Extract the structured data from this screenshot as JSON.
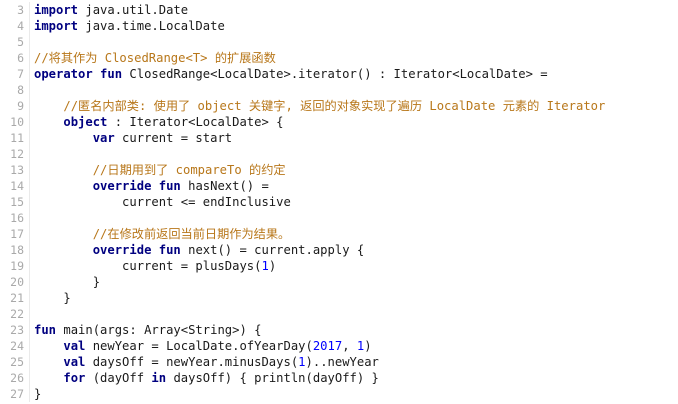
{
  "editor": {
    "language": "Kotlin",
    "lines": [
      {
        "n": "3",
        "tokens": [
          {
            "t": "kw",
            "v": "import"
          },
          {
            "t": "txt",
            "v": " java.util.Date"
          }
        ]
      },
      {
        "n": "4",
        "tokens": [
          {
            "t": "kw",
            "v": "import"
          },
          {
            "t": "txt",
            "v": " java.time.LocalDate"
          }
        ]
      },
      {
        "n": "5",
        "tokens": []
      },
      {
        "n": "6",
        "tokens": [
          {
            "t": "com",
            "v": "//将其作为 ClosedRange<T> 的扩展函数"
          }
        ]
      },
      {
        "n": "7",
        "tokens": [
          {
            "t": "kw",
            "v": "operator"
          },
          {
            "t": "txt",
            "v": " "
          },
          {
            "t": "kw",
            "v": "fun"
          },
          {
            "t": "txt",
            "v": " ClosedRange<LocalDate>.iterator() : Iterator<LocalDate> ="
          }
        ]
      },
      {
        "n": "8",
        "tokens": []
      },
      {
        "n": "9",
        "tokens": [
          {
            "t": "txt",
            "v": "    "
          },
          {
            "t": "com",
            "v": "//匿名内部类: 使用了 object 关键字, 返回的对象实现了遍历 LocalDate 元素的 Iterator"
          }
        ]
      },
      {
        "n": "10",
        "tokens": [
          {
            "t": "txt",
            "v": "    "
          },
          {
            "t": "kw",
            "v": "object"
          },
          {
            "t": "txt",
            "v": " : Iterator<LocalDate> {"
          }
        ]
      },
      {
        "n": "11",
        "tokens": [
          {
            "t": "txt",
            "v": "        "
          },
          {
            "t": "kw",
            "v": "var"
          },
          {
            "t": "txt",
            "v": " current = start"
          }
        ]
      },
      {
        "n": "12",
        "tokens": []
      },
      {
        "n": "13",
        "tokens": [
          {
            "t": "txt",
            "v": "        "
          },
          {
            "t": "com",
            "v": "//日期用到了 compareTo 的约定"
          }
        ]
      },
      {
        "n": "14",
        "tokens": [
          {
            "t": "txt",
            "v": "        "
          },
          {
            "t": "kw",
            "v": "override"
          },
          {
            "t": "txt",
            "v": " "
          },
          {
            "t": "kw",
            "v": "fun"
          },
          {
            "t": "txt",
            "v": " hasNext() ="
          }
        ]
      },
      {
        "n": "15",
        "tokens": [
          {
            "t": "txt",
            "v": "            current <= endInclusive"
          }
        ]
      },
      {
        "n": "16",
        "tokens": []
      },
      {
        "n": "17",
        "tokens": [
          {
            "t": "txt",
            "v": "        "
          },
          {
            "t": "com",
            "v": "//在修改前返回当前日期作为结果。"
          }
        ]
      },
      {
        "n": "18",
        "tokens": [
          {
            "t": "txt",
            "v": "        "
          },
          {
            "t": "kw",
            "v": "override"
          },
          {
            "t": "txt",
            "v": " "
          },
          {
            "t": "kw",
            "v": "fun"
          },
          {
            "t": "txt",
            "v": " next() = current.apply {"
          }
        ]
      },
      {
        "n": "19",
        "tokens": [
          {
            "t": "txt",
            "v": "            current = plusDays("
          },
          {
            "t": "num",
            "v": "1"
          },
          {
            "t": "txt",
            "v": ")"
          }
        ]
      },
      {
        "n": "20",
        "tokens": [
          {
            "t": "txt",
            "v": "        }"
          }
        ]
      },
      {
        "n": "21",
        "tokens": [
          {
            "t": "txt",
            "v": "    }"
          }
        ]
      },
      {
        "n": "22",
        "tokens": []
      },
      {
        "n": "23",
        "tokens": [
          {
            "t": "kw",
            "v": "fun"
          },
          {
            "t": "txt",
            "v": " main(args: Array<String>) {"
          }
        ]
      },
      {
        "n": "24",
        "tokens": [
          {
            "t": "txt",
            "v": "    "
          },
          {
            "t": "kw",
            "v": "val"
          },
          {
            "t": "txt",
            "v": " newYear = LocalDate.ofYearDay("
          },
          {
            "t": "num",
            "v": "2017"
          },
          {
            "t": "txt",
            "v": ", "
          },
          {
            "t": "num",
            "v": "1"
          },
          {
            "t": "txt",
            "v": ")"
          }
        ]
      },
      {
        "n": "25",
        "tokens": [
          {
            "t": "txt",
            "v": "    "
          },
          {
            "t": "kw",
            "v": "val"
          },
          {
            "t": "txt",
            "v": " daysOff = newYear.minusDays("
          },
          {
            "t": "num",
            "v": "1"
          },
          {
            "t": "txt",
            "v": ")..newYear"
          }
        ]
      },
      {
        "n": "26",
        "tokens": [
          {
            "t": "txt",
            "v": "    "
          },
          {
            "t": "kw",
            "v": "for"
          },
          {
            "t": "txt",
            "v": " (dayOff "
          },
          {
            "t": "kw",
            "v": "in"
          },
          {
            "t": "txt",
            "v": " daysOff) { println(dayOff) }"
          }
        ]
      },
      {
        "n": "27",
        "tokens": [
          {
            "t": "txt",
            "v": "}"
          }
        ]
      }
    ]
  },
  "colors": {
    "keyword": "#000080",
    "comment": "#b8771a",
    "number": "#0000ff",
    "text": "#1a1a1a",
    "gutter": "#a9a9a9",
    "background": "#ffffff"
  }
}
